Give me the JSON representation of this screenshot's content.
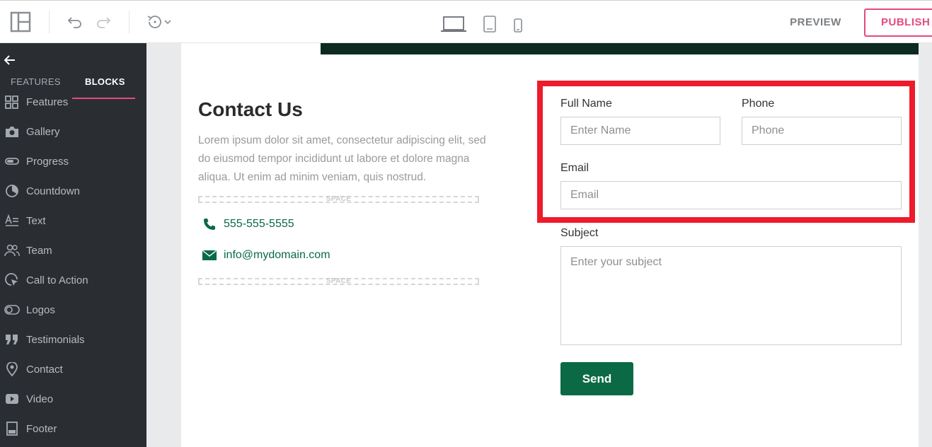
{
  "topbar": {
    "layout_icon": "layout-panels-icon",
    "undo_icon": "undo-icon",
    "redo_icon": "redo-icon",
    "history_icon": "history-icon",
    "devices": [
      "desktop-icon",
      "tablet-icon",
      "mobile-icon"
    ],
    "preview_label": "PREVIEW",
    "publish_label": "PUBLISH",
    "accent_color": "#e6497e"
  },
  "sidebar": {
    "tabs": [
      {
        "label": "FEATURES",
        "active": false
      },
      {
        "label": "BLOCKS",
        "active": true
      }
    ],
    "items": [
      {
        "label": "Features",
        "icon": "features-grid-icon"
      },
      {
        "label": "Gallery",
        "icon": "camera-icon"
      },
      {
        "label": "Progress",
        "icon": "progress-bar-icon"
      },
      {
        "label": "Countdown",
        "icon": "countdown-clock-icon"
      },
      {
        "label": "Text",
        "icon": "text-align-icon"
      },
      {
        "label": "Team",
        "icon": "team-users-icon"
      },
      {
        "label": "Call to Action",
        "icon": "pointer-click-icon"
      },
      {
        "label": "Logos",
        "icon": "logos-toggle-icon"
      },
      {
        "label": "Testimonials",
        "icon": "quote-icon"
      },
      {
        "label": "Contact",
        "icon": "map-pin-icon"
      },
      {
        "label": "Video",
        "icon": "play-video-icon"
      },
      {
        "label": "Footer",
        "icon": "footer-block-icon"
      }
    ]
  },
  "contact": {
    "title": "Contact Us",
    "description": "Lorem ipsum dolor sit amet, consectetur adipiscing elit, sed do eiusmod tempor incididunt ut labore et dolore magna aliqua. Ut enim ad minim veniam, quis nostrud.",
    "space_label": "SPACE",
    "phone": "555-555-5555",
    "email": "info@mydomain.com",
    "brand_color": "#0b6a45"
  },
  "form": {
    "full_name_label": "Full Name",
    "full_name_placeholder": "Enter Name",
    "phone_label": "Phone",
    "phone_placeholder": "Phone",
    "email_label": "Email",
    "email_placeholder": "Email",
    "subject_label": "Subject",
    "subject_placeholder": "Enter your subject",
    "send_label": "Send"
  },
  "highlight_color": "#ee1b2b"
}
